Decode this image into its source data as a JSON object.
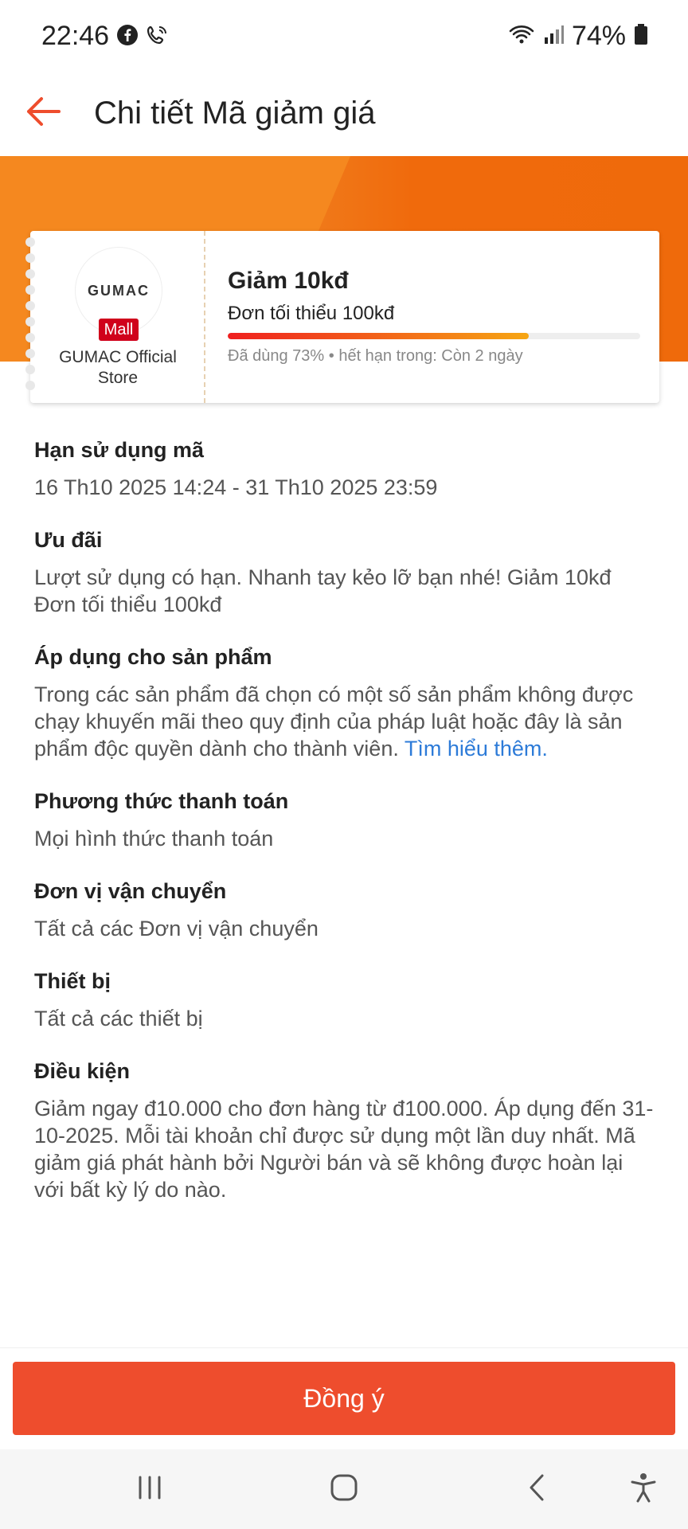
{
  "status": {
    "time": "22:46",
    "battery": "74%",
    "icons": [
      "facebook-icon",
      "wifi-calling-icon",
      "wifi-icon",
      "signal-icon",
      "battery-icon"
    ]
  },
  "header": {
    "title": "Chi tiết Mã giảm giá",
    "back_icon": "arrow-left-icon"
  },
  "voucher": {
    "logo_text": "GUMAC",
    "mall_label": "Mall",
    "store_name": "GUMAC Official Store",
    "title": "Giảm 10kđ",
    "min_order": "Đơn tối thiểu 100kđ",
    "used_percent": 73,
    "usage_text": "Đã dùng 73% • hết hạn trong: Còn 2 ngày"
  },
  "sections": {
    "validity": {
      "title": "Hạn sử dụng mã",
      "body": "16 Th10 2025 14:24 - 31 Th10 2025 23:59"
    },
    "offer": {
      "title": "Ưu đãi",
      "body": "Lượt sử dụng có hạn. Nhanh tay kẻo lỡ bạn nhé! Giảm 10kđ Đơn tối thiểu 100kđ"
    },
    "products": {
      "title": "Áp dụng cho sản phẩm",
      "body": "Trong các sản phẩm đã chọn có một số sản phẩm không được chạy khuyến mãi theo quy định của pháp luật hoặc đây là sản phẩm độc quyền dành cho thành viên.",
      "link": "Tìm hiểu thêm."
    },
    "payment": {
      "title": "Phương thức thanh toán",
      "body": "Mọi hình thức thanh toán"
    },
    "shipping": {
      "title": "Đơn vị vận chuyển",
      "body": "Tất cả các Đơn vị vận chuyển"
    },
    "device": {
      "title": "Thiết bị",
      "body": "Tất cả các thiết bị"
    },
    "conditions": {
      "title": "Điều kiện",
      "body": "Giảm ngay đ10.000 cho đơn hàng từ đ100.000. Áp dụng đến 31-10-2025. Mỗi tài khoản chỉ được sử dụng một lần duy nhất. Mã giảm giá phát hành bởi Người bán và sẽ không được hoàn lại với bất kỳ lý do nào."
    }
  },
  "footer": {
    "agree_label": "Đồng ý"
  },
  "colors": {
    "accent": "#ee4d2d",
    "banner": "#f07a1a",
    "link": "#2d7bd8",
    "mall": "#d0011b"
  }
}
